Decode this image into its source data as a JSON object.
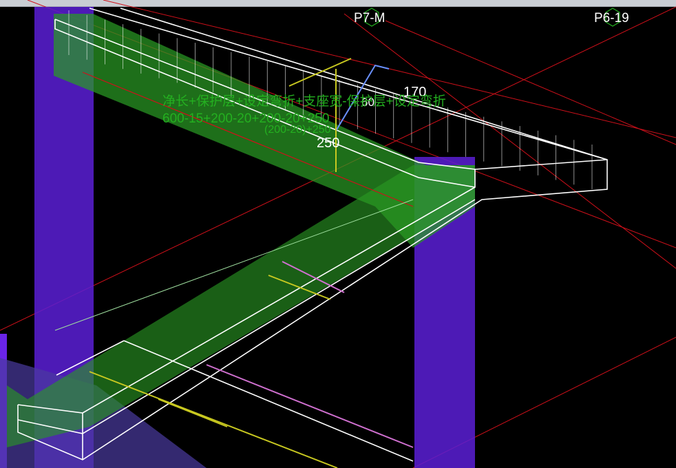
{
  "axis_labels": {
    "p7m": "P7-M",
    "p619": "P6-19"
  },
  "dimensions": {
    "d170": "170",
    "d250": "250",
    "d60": "60"
  },
  "formula": {
    "line1": "净长+保护层+设定弯折+支座宽-保护层+设定弯折",
    "line2": "600-15+200-20+200-20+250",
    "line3": "(200-20)+250"
  },
  "colors": {
    "background": "#000000",
    "column": "#5b1fd6",
    "beam_fill": "#2a9a24",
    "wire": "#ffffff",
    "axis_line": "#d0101a",
    "rebar_yellow": "#c8c820",
    "rebar_pink": "#d070d0",
    "rebar_blue": "#6a90ff",
    "label_green": "#24b020"
  }
}
